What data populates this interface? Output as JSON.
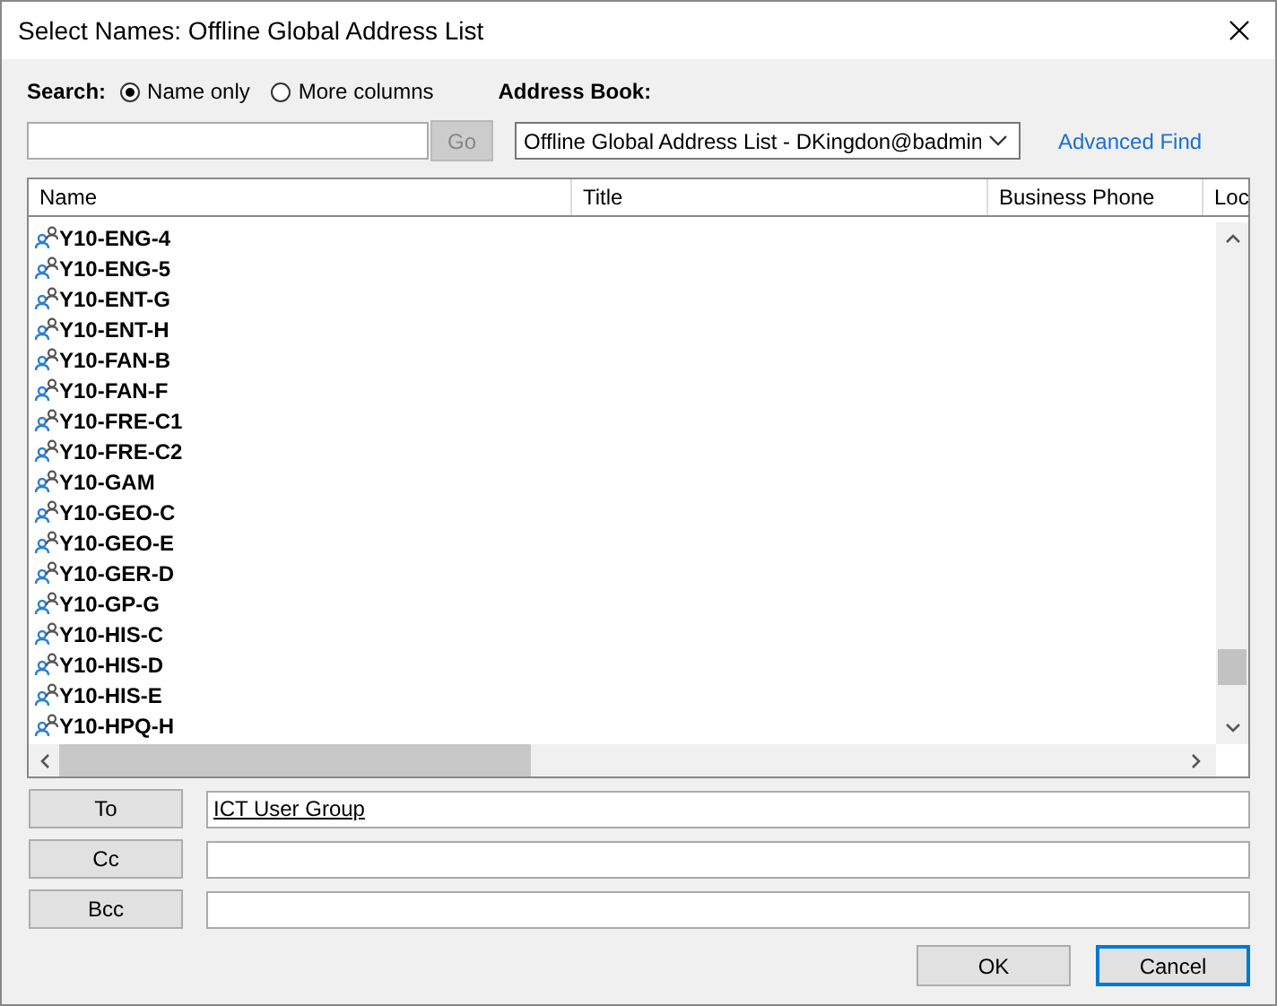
{
  "window": {
    "title": "Select Names: Offline Global Address List"
  },
  "search": {
    "label": "Search:",
    "options": [
      {
        "label": "Name only",
        "selected": true
      },
      {
        "label": "More columns",
        "selected": false
      }
    ]
  },
  "go_button": {
    "label": "Go",
    "disabled": true
  },
  "address_book": {
    "label": "Address Book:",
    "value": "Offline Global Address List - DKingdon@badmin"
  },
  "advanced_find": "Advanced Find",
  "table": {
    "columns": [
      "Name",
      "Title",
      "Business Phone",
      "Loc"
    ],
    "rows": [
      {
        "name": "Y10-ENG-4"
      },
      {
        "name": "Y10-ENG-5"
      },
      {
        "name": "Y10-ENT-G"
      },
      {
        "name": "Y10-ENT-H"
      },
      {
        "name": "Y10-FAN-B"
      },
      {
        "name": "Y10-FAN-F"
      },
      {
        "name": "Y10-FRE-C1"
      },
      {
        "name": "Y10-FRE-C2"
      },
      {
        "name": "Y10-GAM"
      },
      {
        "name": "Y10-GEO-C"
      },
      {
        "name": "Y10-GEO-E"
      },
      {
        "name": "Y10-GER-D"
      },
      {
        "name": "Y10-GP-G"
      },
      {
        "name": "Y10-HIS-C"
      },
      {
        "name": "Y10-HIS-D"
      },
      {
        "name": "Y10-HIS-E"
      },
      {
        "name": "Y10-HPQ-H"
      }
    ]
  },
  "recipients": [
    {
      "label": "To",
      "value": "ICT User Group"
    },
    {
      "label": "Cc"
    },
    {
      "label": "Bcc"
    }
  ],
  "buttons": [
    {
      "label": "OK",
      "focused": false
    },
    {
      "label": "Cancel",
      "focused": true
    }
  ]
}
